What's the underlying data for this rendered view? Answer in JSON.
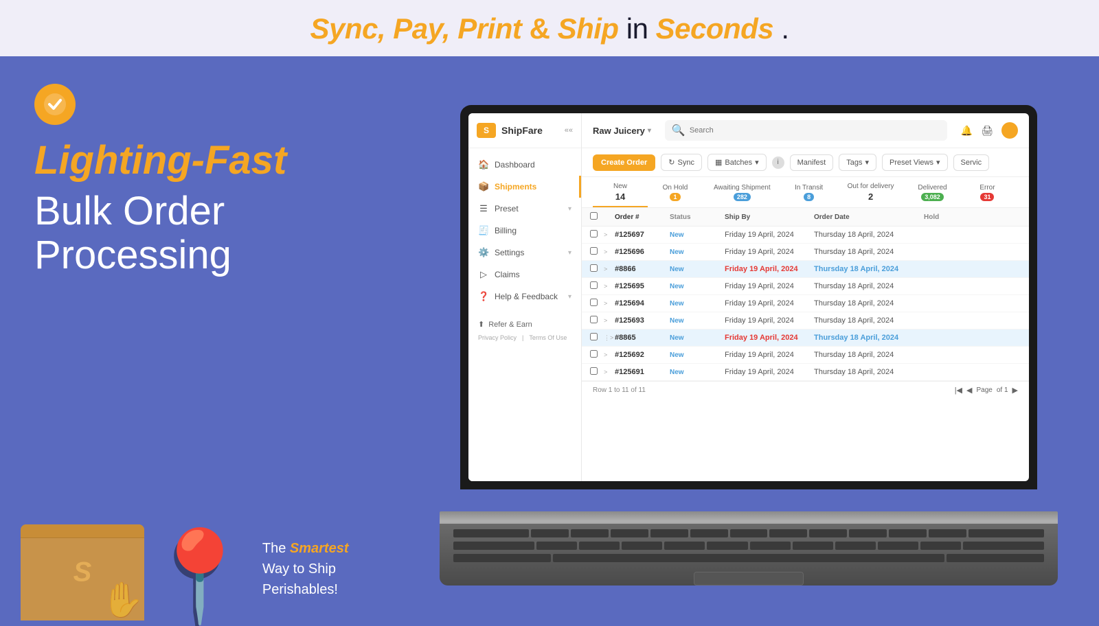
{
  "banner": {
    "text_1": "Sync, Pay, Print",
    "text_2": " & ",
    "text_3": "Ship",
    "text_4": " in ",
    "text_5": "Seconds",
    "text_6": "."
  },
  "hero": {
    "title_italic": "Lighting-Fast",
    "subtitle_line1": "Bulk Order",
    "subtitle_line2": "Processing"
  },
  "tagline": {
    "prefix": "The ",
    "bold": "Smartest",
    "suffix_1": " Way to Ship",
    "suffix_2": "Perishables!"
  },
  "sidebar": {
    "logo": "ShipFare",
    "items": [
      {
        "label": "Dashboard",
        "icon": "🏠",
        "active": false,
        "hasArrow": false
      },
      {
        "label": "Shipments",
        "icon": "📦",
        "active": true,
        "hasArrow": false
      },
      {
        "label": "Preset",
        "icon": "☰",
        "active": false,
        "hasArrow": true
      },
      {
        "label": "Billing",
        "icon": "🧾",
        "active": false,
        "hasArrow": false
      },
      {
        "label": "Settings",
        "icon": "⚙️",
        "active": false,
        "hasArrow": true
      },
      {
        "label": "Claims",
        "icon": "▷",
        "active": false,
        "hasArrow": false
      },
      {
        "label": "Help & Feedback",
        "icon": "❓",
        "active": false,
        "hasArrow": true
      }
    ],
    "refer_label": "Refer & Earn",
    "footer": {
      "privacy": "Privacy Policy",
      "terms": "Terms Of Use"
    }
  },
  "nav": {
    "store": "Raw Juicery",
    "search_placeholder": "Search"
  },
  "toolbar": {
    "create_order": "Create Order",
    "sync": "Sync",
    "batches": "Batches",
    "manifest": "Manifest",
    "tags": "Tags",
    "preset_views": "Preset Views",
    "services": "Servic"
  },
  "status_tabs": [
    {
      "label": "New",
      "count": "14",
      "badge": "",
      "badge_class": ""
    },
    {
      "label": "On Hold",
      "count": "1",
      "badge": "1",
      "badge_class": "badge-orange"
    },
    {
      "label": "Awaiting Shipment",
      "count": "282",
      "badge": "282",
      "badge_class": "badge-blue"
    },
    {
      "label": "In Transit",
      "count": "8",
      "badge": "8",
      "badge_class": "badge-blue"
    },
    {
      "label": "Out for delivery",
      "count": "2",
      "badge": "",
      "badge_class": ""
    },
    {
      "label": "Delivered",
      "count": "3,082",
      "badge": "3,082",
      "badge_class": "badge-green"
    },
    {
      "label": "Error",
      "count": "31",
      "badge": "31",
      "badge_class": "badge-red"
    }
  ],
  "table": {
    "headers": [
      "",
      "",
      "Order #",
      "Status",
      "Ship By",
      "Order Date",
      "Hold"
    ],
    "rows": [
      {
        "id": "#125697",
        "status": "New",
        "ship_by": "Friday 19 April, 2024",
        "order_date": "Thursday 18 April, 2024",
        "highlighted": false
      },
      {
        "id": "#125696",
        "status": "New",
        "ship_by": "Friday 19 April, 2024",
        "order_date": "Thursday 18 April, 2024",
        "highlighted": false
      },
      {
        "id": "#8866",
        "status": "New",
        "ship_by": "Friday 19 April, 2024",
        "order_date": "Thursday 18 April, 2024",
        "highlighted": true
      },
      {
        "id": "#125695",
        "status": "New",
        "ship_by": "Friday 19 April, 2024",
        "order_date": "Thursday 18 April, 2024",
        "highlighted": false
      },
      {
        "id": "#125694",
        "status": "New",
        "ship_by": "Friday 19 April, 2024",
        "order_date": "Thursday 18 April, 2024",
        "highlighted": false
      },
      {
        "id": "#125693",
        "status": "New",
        "ship_by": "Friday 19 April, 2024",
        "order_date": "Thursday 18 April, 2024",
        "highlighted": false
      },
      {
        "id": "#8865",
        "status": "New",
        "ship_by": "Friday 19 April, 2024",
        "order_date": "Thursday 18 April, 2024",
        "highlighted": true
      },
      {
        "id": "#125692",
        "status": "New",
        "ship_by": "Friday 19 April, 2024",
        "order_date": "Thursday 18 April, 2024",
        "highlighted": false
      },
      {
        "id": "#125691",
        "status": "New",
        "ship_by": "Friday 19 April, 2024",
        "order_date": "Thursday 18 April, 2024",
        "highlighted": false
      }
    ],
    "footer": {
      "row_info": "Row 1 to 11 of 11",
      "page_label": "Page",
      "of_label": "of 1"
    }
  }
}
